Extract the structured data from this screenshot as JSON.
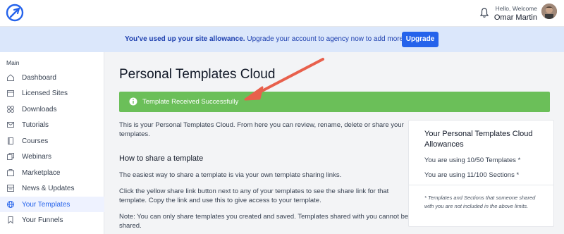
{
  "header": {
    "greeting": "Hello, Welcome",
    "user_name": "Omar Martin"
  },
  "banner": {
    "message_bold": "You've used up your site allowance.",
    "message_rest": " Upgrade your account to agency now to add more sites.",
    "upgrade_label": "Upgrade"
  },
  "sidebar": {
    "heading": "Main",
    "items": [
      {
        "label": "Dashboard",
        "icon": "dashboard-icon"
      },
      {
        "label": "Licensed Sites",
        "icon": "calendar-icon"
      },
      {
        "label": "Downloads",
        "icon": "grid-icon"
      },
      {
        "label": "Tutorials",
        "icon": "mail-icon"
      },
      {
        "label": "Courses",
        "icon": "book-icon"
      },
      {
        "label": "Webinars",
        "icon": "copy-icon"
      },
      {
        "label": "Marketplace",
        "icon": "shop-icon"
      },
      {
        "label": "News & Updates",
        "icon": "news-icon"
      },
      {
        "label": "Your Templates",
        "icon": "globe-icon",
        "active": true
      },
      {
        "label": "Your Funnels",
        "icon": "bookmark-icon"
      }
    ]
  },
  "main": {
    "title": "Personal Templates Cloud",
    "success_message": "Template Received Successfully",
    "intro_line1": "This is your Personal Templates Cloud. From here you can review, rename, delete or share your",
    "intro_line2": "templates.",
    "how_to_heading": "How to share a template",
    "para1": "The easiest way to share a template is via your own template sharing links.",
    "para2_line1": "Click the yellow share link button next to any of your templates to see the share link for that",
    "para2_line2": "template. Copy the link and use this to give access to your template.",
    "para3_line1": "Note: You can only share templates you created and saved. Templates shared with you cannot be",
    "para3_line2": "shared."
  },
  "allowance_card": {
    "title": "Your Personal Templates Cloud Allowances",
    "templates_line": "You are using 10/50 Templates *",
    "sections_line": "You are using 11/100 Sections *",
    "note": "* Templates and Sections that someone shared with you are not included in the above limits."
  },
  "colors": {
    "accent": "#2563eb",
    "success": "#6bbf59",
    "banner_bg": "#dbe7fb",
    "annotation_arrow": "#e8604c"
  }
}
